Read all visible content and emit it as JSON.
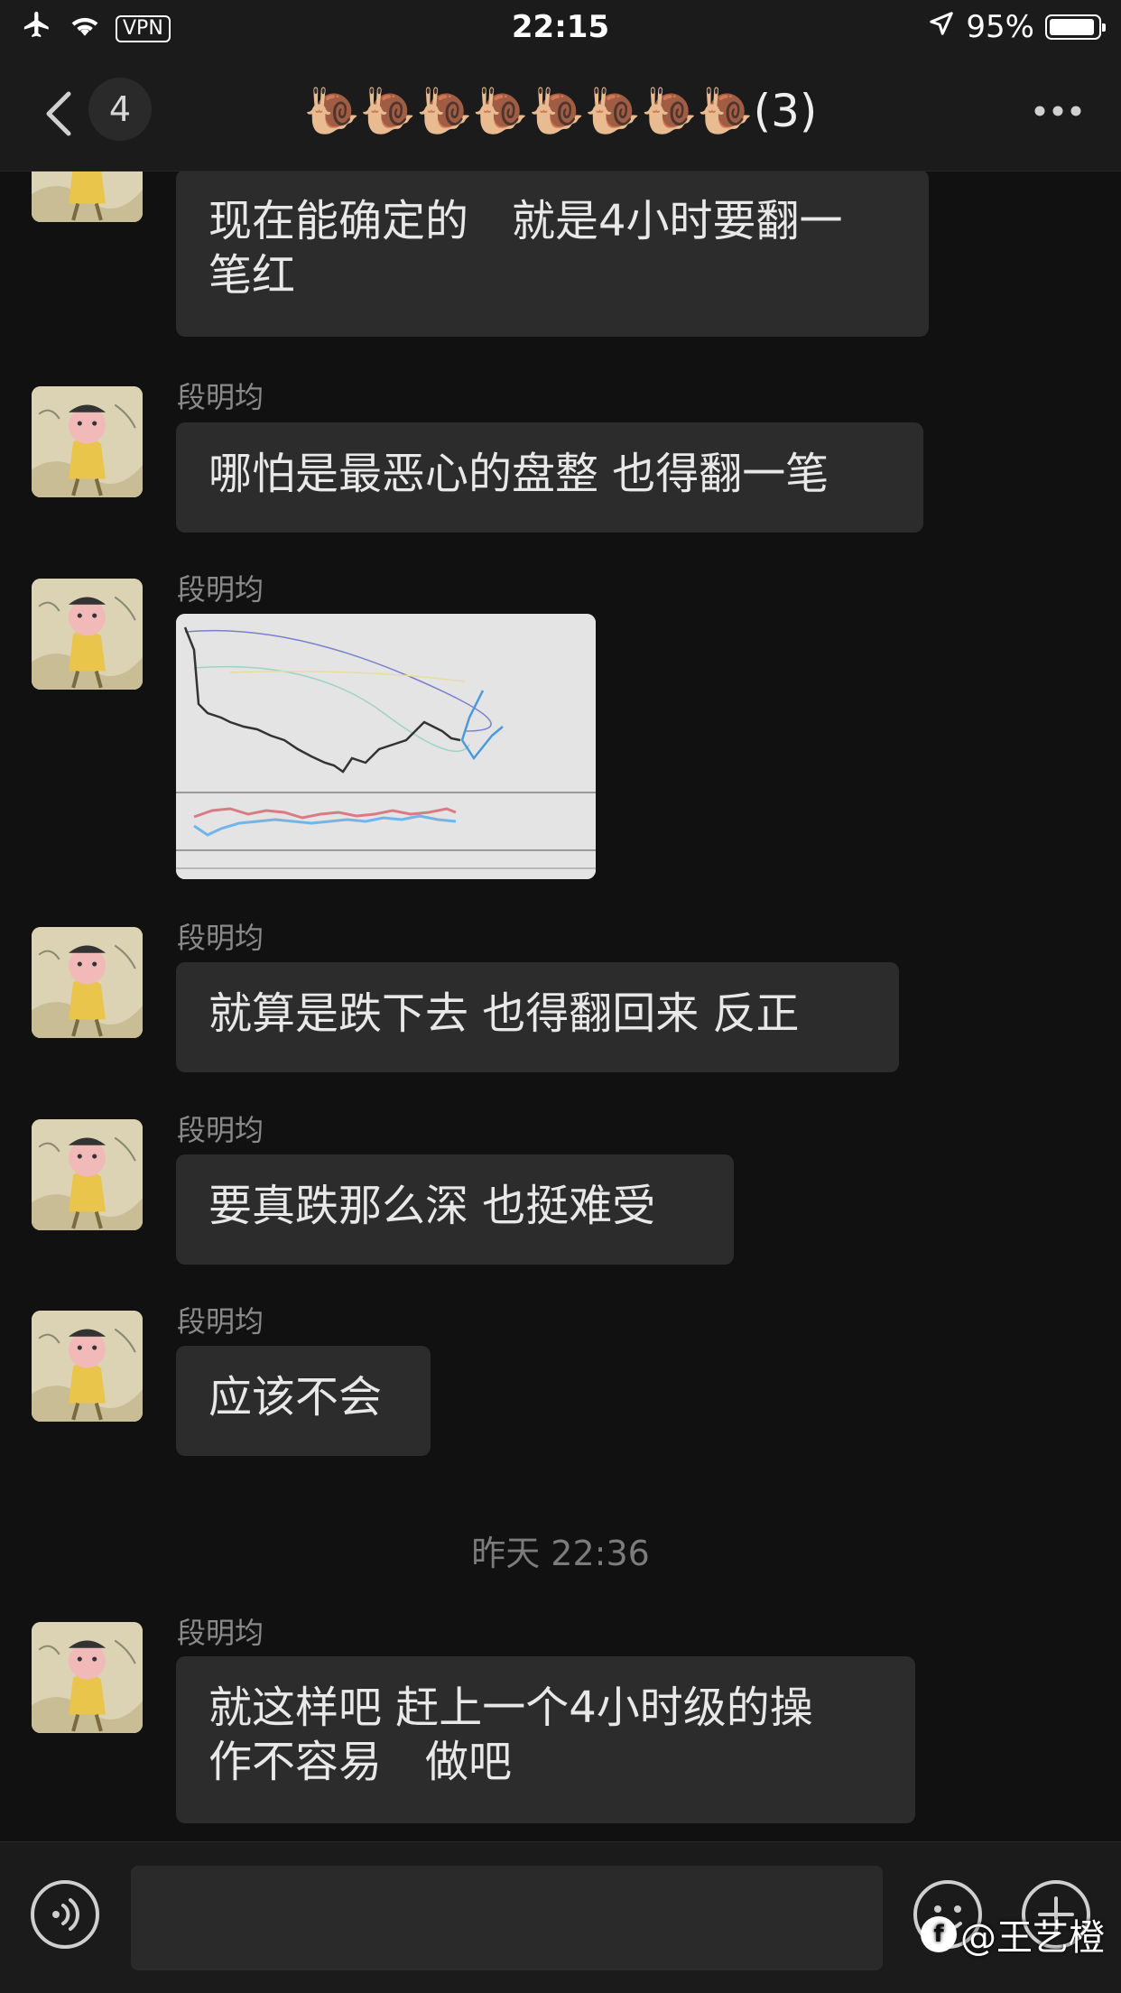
{
  "status_bar": {
    "vpn_label": "VPN",
    "time": "22:15",
    "battery_percent": "95%",
    "battery_level": 0.95
  },
  "nav": {
    "unread_count": "4",
    "chat_title": "🐌🐌🐌🐌🐌🐌🐌🐌(3)"
  },
  "messages": [
    {
      "sender": "",
      "text": "现在能确定的　就是4小时要翻一\n笔红"
    },
    {
      "sender": "段明均",
      "text": "哪怕是最恶心的盘整  也得翻一笔"
    },
    {
      "sender": "段明均",
      "type": "image",
      "icon": "stock-chart-thumbnail"
    },
    {
      "sender": "段明均",
      "text": "就算是跌下去  也得翻回来  反正"
    },
    {
      "sender": "段明均",
      "text": "要真跌那么深  也挺难受"
    },
    {
      "sender": "段明均",
      "text": "应该不会"
    },
    {
      "timestamp": "昨天 22:36"
    },
    {
      "sender": "段明均",
      "text": "就这样吧  赶上一个4小时级的操\n作不容易　做吧"
    }
  ],
  "input_bar": {
    "text_value": "",
    "placeholder": ""
  },
  "watermark": {
    "text": "@王艺橙",
    "logo_letter": "f"
  },
  "icons": [
    "airplane-icon",
    "wifi-icon",
    "location-arrow-icon",
    "battery-icon",
    "back-chevron-icon",
    "more-icon",
    "voice-icon",
    "emoji-icon",
    "plus-icon"
  ]
}
